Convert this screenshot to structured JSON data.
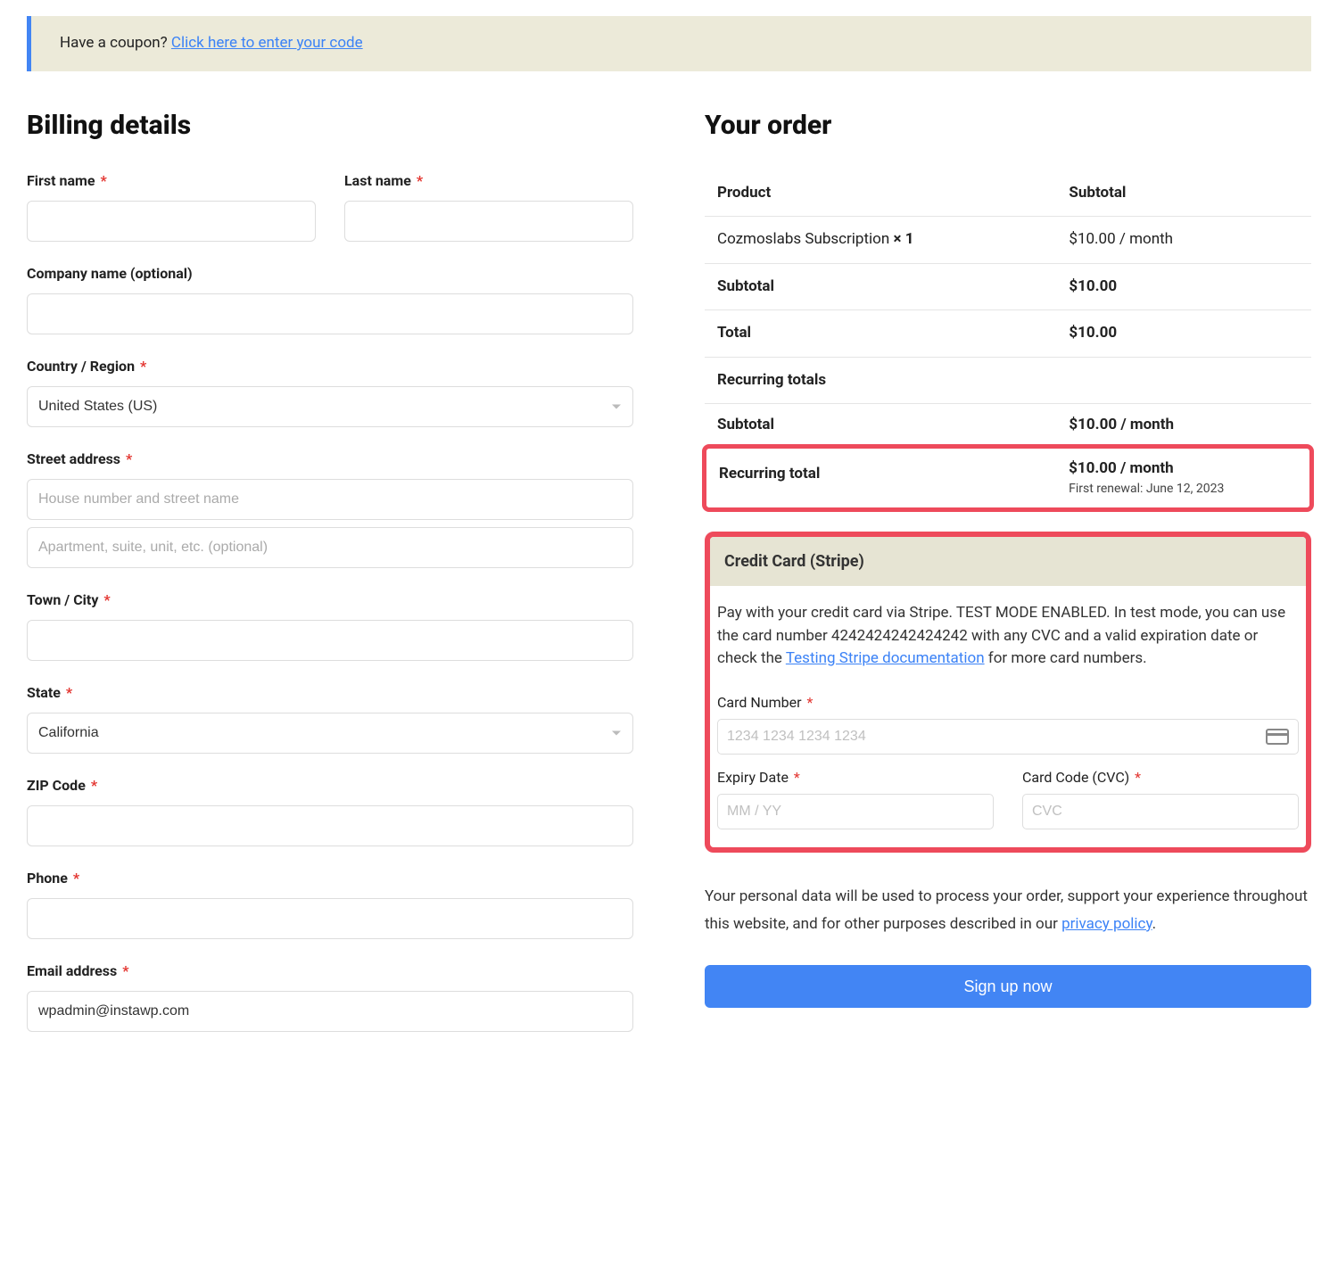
{
  "coupon": {
    "prompt": "Have a coupon? ",
    "link": "Click here to enter your code"
  },
  "billing": {
    "heading": "Billing details",
    "first_name_label": "First name",
    "last_name_label": "Last name",
    "company_label": "Company name (optional)",
    "country_label": "Country / Region",
    "country_value": "United States (US)",
    "street_label": "Street address",
    "street1_placeholder": "House number and street name",
    "street2_placeholder": "Apartment, suite, unit, etc. (optional)",
    "city_label": "Town / City",
    "state_label": "State",
    "state_value": "California",
    "zip_label": "ZIP Code",
    "phone_label": "Phone",
    "email_label": "Email address",
    "email_value": "wpadmin@instawp.com"
  },
  "order": {
    "heading": "Your order",
    "header_product": "Product",
    "header_subtotal": "Subtotal",
    "item_name": "Cozmoslabs Subscription ",
    "item_qty": " × 1",
    "item_price": "$10.00 / month",
    "subtotal_label": "Subtotal",
    "subtotal_value": "$10.00",
    "total_label": "Total",
    "total_value": "$10.00",
    "recurring_header": "Recurring totals",
    "recurring_subtotal_label": "Subtotal",
    "recurring_subtotal_value": "$10.00 / month",
    "recurring_total_label": "Recurring total",
    "recurring_total_value": "$10.00 / month",
    "first_renewal": "First renewal: June 12, 2023"
  },
  "payment": {
    "header": "Credit Card (Stripe)",
    "desc_prefix": "Pay with your credit card via Stripe. TEST MODE ENABLED. In test mode, you can use the card number 4242424242424242 with any CVC and a valid expiration date or check the ",
    "desc_link": "Testing Stripe documentation",
    "desc_suffix": " for more card numbers.",
    "card_number_label": "Card Number",
    "card_number_placeholder": "1234 1234 1234 1234",
    "expiry_label": "Expiry Date",
    "expiry_placeholder": "MM / YY",
    "cvc_label": "Card Code (CVC)",
    "cvc_placeholder": "CVC"
  },
  "privacy": {
    "text_prefix": "Your personal data will be used to process your order, support your experience throughout this website, and for other purposes described in our ",
    "link": "privacy policy",
    "suffix": "."
  },
  "button": {
    "signup": "Sign up now"
  }
}
